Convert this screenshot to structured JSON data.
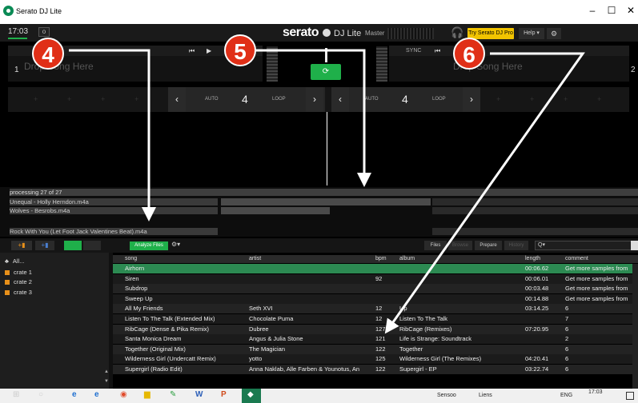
{
  "window": {
    "title": "Serato DJ Lite",
    "controls": [
      "–",
      "☐",
      "✕"
    ]
  },
  "header": {
    "clock": "17:03",
    "small_box": "o",
    "brand": "serato",
    "brand_lite": "DJ Lite",
    "master_label": "Master",
    "try_button": "Try Serato DJ Pro",
    "help_button": "Help ▾",
    "settings_icon": "gear-icon"
  },
  "decks": {
    "left": {
      "number": "1",
      "placeholder": "Drop Song Here"
    },
    "right": {
      "number": "2",
      "placeholder": "Drop Song Here"
    },
    "transport": [
      "⏮",
      "▶"
    ],
    "sync_label": "SYNC",
    "center_button": "⟳"
  },
  "loops": {
    "left": {
      "auto": "AUTO",
      "value": "4",
      "loop": "LOOP"
    },
    "right": {
      "auto": "AUTO",
      "value": "4",
      "loop": "LOOP"
    }
  },
  "prepare": {
    "status": "processing 27 of 27",
    "items": [
      "Unequal - Holly Herndon.m4a",
      "Wolves - Besrobs.m4a",
      "Rock With You (Let Foot Jack Valentines Beat).m4a"
    ],
    "progress": [
      1.0,
      0.52,
      0.0
    ]
  },
  "library_toolbar": {
    "analyze_button": "Analyze Files",
    "files_button": "Files",
    "browse_button": "Browse",
    "prepare_button": "Prepare",
    "history_button": "History",
    "search_placeholder": "Q▾"
  },
  "crates": [
    {
      "label": "All...",
      "icon": "all-icon"
    },
    {
      "label": "crate 1",
      "icon": "crate-icon"
    },
    {
      "label": "crate 2",
      "icon": "crate-icon"
    },
    {
      "label": "crate 3",
      "icon": "crate-icon"
    }
  ],
  "table": {
    "columns": [
      "song",
      "artist",
      "bpm",
      "album",
      "length",
      "comment"
    ],
    "rows": [
      {
        "song": "Airhorn",
        "artist": "",
        "bpm": "",
        "album": "",
        "length": "00:06.62",
        "comment": "Get more samples from",
        "selected": true
      },
      {
        "song": "Siren",
        "artist": "",
        "bpm": "92",
        "album": "",
        "length": "00:06.01",
        "comment": "Get more samples from"
      },
      {
        "song": "Subdrop",
        "artist": "",
        "bpm": "",
        "album": "",
        "length": "00:03.48",
        "comment": "Get more samples from"
      },
      {
        "song": "Sweep Up",
        "artist": "",
        "bpm": "",
        "album": "",
        "length": "00:14.88",
        "comment": "Get more samples from"
      },
      {
        "song": "All My Friends",
        "artist": "Seth XVI",
        "bpm": "12",
        "album": "Up",
        "length": "03:14.25",
        "comment": "6"
      },
      {
        "song": "Listen To The Talk (Extended Mix)",
        "artist": "Chocolate Puma",
        "bpm": "12",
        "album": "Listen To The Talk",
        "length": "",
        "comment": "7"
      },
      {
        "song": "RibCage (Dense & Pika Remix)",
        "artist": "Dubree",
        "bpm": "127",
        "album": "RibCage (Remixes)",
        "length": "07:20.95",
        "comment": "6"
      },
      {
        "song": "Santa Monica Dream",
        "artist": "Angus & Julia Stone",
        "bpm": "121",
        "album": "Life is Strange: Soundtrack",
        "length": "",
        "comment": "2"
      },
      {
        "song": "Together (Original Mix)",
        "artist": "The Magician",
        "bpm": "122",
        "album": "Together",
        "length": "",
        "comment": "6"
      },
      {
        "song": "Wilderness Girl (Undercatt Remix)",
        "artist": "yotto",
        "bpm": "125",
        "album": "Wilderness Girl (The Remixes)",
        "length": "04:20.41",
        "comment": "6"
      },
      {
        "song": "Supergirl (Radio Edit)",
        "artist": "Anna Naklab, Alle Farben & Younotus, An",
        "bpm": "122",
        "album": "Supergirl - EP",
        "length": "03:22.74",
        "comment": "6"
      }
    ]
  },
  "taskbar": {
    "apps": [
      "⊞",
      "○",
      "e",
      "e",
      "◉",
      "▆",
      "✎",
      "W",
      "P",
      "◆"
    ],
    "tray_text": [
      "Sensoo",
      "Liens",
      "ENG",
      "17:03"
    ]
  },
  "callouts": [
    "4",
    "5",
    "6"
  ],
  "colors": {
    "accent_green": "#1fb04a",
    "selected_row": "#2c8a52",
    "try_pro_yellow": "#f2c400",
    "callout_red": "#e02f17",
    "crate_orange": "#e8901a"
  }
}
